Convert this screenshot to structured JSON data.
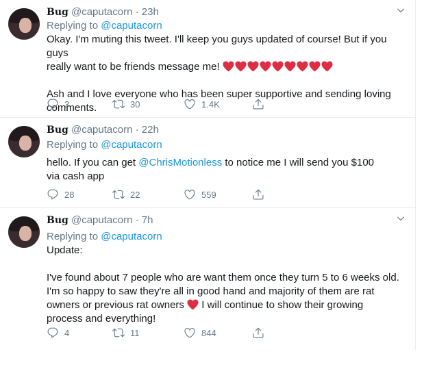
{
  "tweets": [
    {
      "name": "Bug",
      "handle": "@caputacorn",
      "dot": "·",
      "time": "23h",
      "replying_prefix": "Replying to",
      "replying_to": "@caputacorn",
      "text_lines": [
        "Okay. I'm muting this tweet. I'll keep you guys updated of course! But if you guys",
        "really want to be friends message me!"
      ],
      "heart_emoji_count": 9,
      "text_para2": "Ash and I love everyone who has been super supportive and sending loving comments.",
      "replies": "3",
      "retweets": "30",
      "likes": "1.4K"
    },
    {
      "name": "Bug",
      "handle": "@caputacorn",
      "dot": "·",
      "time": "22h",
      "replying_prefix": "Replying to",
      "replying_to": "@caputacorn",
      "text_before": "hello. If you can get",
      "text_mention": "@ChrisMotionless",
      "text_after": "to notice me I will send you $100 via cash app",
      "replies": "28",
      "retweets": "22",
      "likes": "559"
    },
    {
      "name": "Bug",
      "handle": "@caputacorn",
      "dot": "·",
      "time": "7h",
      "replying_prefix": "Replying to",
      "replying_to": "@caputacorn",
      "text_para1": "Update:",
      "text_para2_before": "I've found about 7 people who are want them once they turn 5 to 6 weeks old. I'm so happy to saw they're all in good hand and majority of them are rat owners or previous rat owners",
      "text_para2_after": "I will continue to show their growing process and everything!",
      "replies": "4",
      "retweets": "11",
      "likes": "844"
    }
  ],
  "colors": {
    "text": "#14171a",
    "muted": "#657786",
    "link": "#1b95e0",
    "heart_emoji": "#dd2e44",
    "divider": "#e6ecf0"
  },
  "icons": [
    "avatar",
    "chevron-down-icon",
    "reply-icon",
    "retweet-icon",
    "like-icon",
    "share-icon",
    "red-heart-emoji"
  ]
}
